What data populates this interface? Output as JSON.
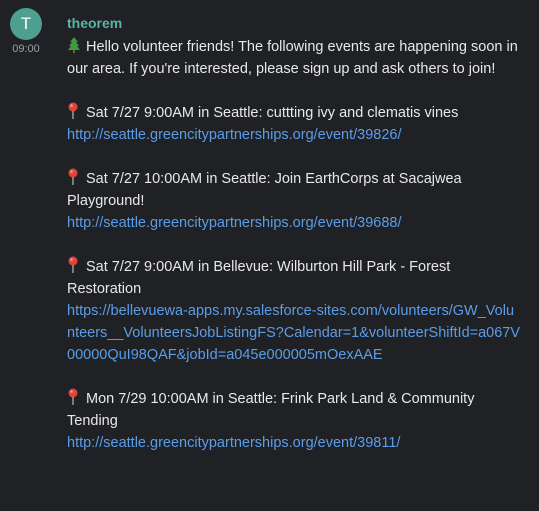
{
  "avatar": {
    "letter": "T",
    "color": "#4e9f8f"
  },
  "timestamp": "09:00",
  "author": "theorem",
  "intro": "Hello volunteer friends! The following events are happening soon in our area. If you're interested, please sign up and ask others to join!",
  "intro_icon": "tree-icon",
  "events": [
    {
      "icon": "pin-icon",
      "text": "Sat 7/27 9:00AM in Seattle: cuttting ivy and clematis vines",
      "link": "http://seattle.greencitypartnerships.org/event/39826/"
    },
    {
      "icon": "pin-icon",
      "text": "Sat 7/27 10:00AM in Seattle: Join EarthCorps at Sacajwea Playground!",
      "link": "http://seattle.greencitypartnerships.org/event/39688/"
    },
    {
      "icon": "pin-icon",
      "text": "Sat 7/27 9:00AM in Bellevue: Wilburton Hill Park - Forest Restoration",
      "link": "https://bellevuewa-apps.my.salesforce-sites.com/volunteers/GW_Volunteers__VolunteersJobListingFS?Calendar=1&volunteerShiftId=a067V00000QuI98QAF&jobId=a045e000005mOexAAE"
    },
    {
      "icon": "pin-icon",
      "text": "Mon 7/29 10:00AM in Seattle: Frink Park Land & Community Tending",
      "link": "http://seattle.greencitypartnerships.org/event/39811/"
    }
  ],
  "colors": {
    "background": "#1f2124",
    "author": "#58b5a5",
    "link": "#5b9de9",
    "text": "#e8e8e8",
    "timestamp": "#9aa0a6"
  }
}
